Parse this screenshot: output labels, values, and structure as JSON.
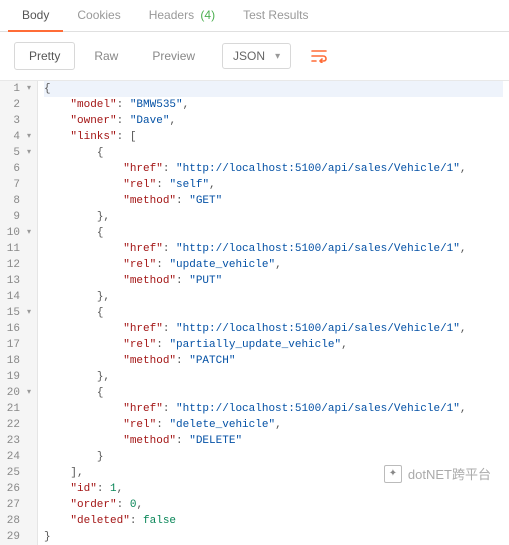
{
  "tabs": {
    "body": "Body",
    "cookies": "Cookies",
    "headers": "Headers",
    "headers_count": "(4)",
    "test_results": "Test Results"
  },
  "toolbar": {
    "pretty": "Pretty",
    "raw": "Raw",
    "preview": "Preview",
    "format": "JSON"
  },
  "watermark": "dotNET跨平台",
  "json_body": {
    "model": "BMW535",
    "owner": "Dave",
    "links": [
      {
        "href": "http://localhost:5100/api/sales/Vehicle/1",
        "rel": "self",
        "method": "GET"
      },
      {
        "href": "http://localhost:5100/api/sales/Vehicle/1",
        "rel": "update_vehicle",
        "method": "PUT"
      },
      {
        "href": "http://localhost:5100/api/sales/Vehicle/1",
        "rel": "partially_update_vehicle",
        "method": "PATCH"
      },
      {
        "href": "http://localhost:5100/api/sales/Vehicle/1",
        "rel": "delete_vehicle",
        "method": "DELETE"
      }
    ],
    "id": 1,
    "order": 0,
    "deleted": false
  },
  "code_lines": [
    {
      "n": 1,
      "fold": true,
      "indent": 0,
      "hl": true,
      "tokens": [
        [
          "p",
          "{"
        ]
      ]
    },
    {
      "n": 2,
      "fold": false,
      "indent": 1,
      "tokens": [
        [
          "k",
          "\"model\""
        ],
        [
          "p",
          ": "
        ],
        [
          "s",
          "\"BMW535\""
        ],
        [
          "p",
          ","
        ]
      ]
    },
    {
      "n": 3,
      "fold": false,
      "indent": 1,
      "tokens": [
        [
          "k",
          "\"owner\""
        ],
        [
          "p",
          ": "
        ],
        [
          "s",
          "\"Dave\""
        ],
        [
          "p",
          ","
        ]
      ]
    },
    {
      "n": 4,
      "fold": true,
      "indent": 1,
      "tokens": [
        [
          "k",
          "\"links\""
        ],
        [
          "p",
          ": ["
        ]
      ]
    },
    {
      "n": 5,
      "fold": true,
      "indent": 2,
      "tokens": [
        [
          "p",
          "{"
        ]
      ]
    },
    {
      "n": 6,
      "fold": false,
      "indent": 3,
      "tokens": [
        [
          "k",
          "\"href\""
        ],
        [
          "p",
          ": "
        ],
        [
          "s",
          "\"http://localhost:5100/api/sales/Vehicle/1\""
        ],
        [
          "p",
          ","
        ]
      ]
    },
    {
      "n": 7,
      "fold": false,
      "indent": 3,
      "tokens": [
        [
          "k",
          "\"rel\""
        ],
        [
          "p",
          ": "
        ],
        [
          "s",
          "\"self\""
        ],
        [
          "p",
          ","
        ]
      ]
    },
    {
      "n": 8,
      "fold": false,
      "indent": 3,
      "tokens": [
        [
          "k",
          "\"method\""
        ],
        [
          "p",
          ": "
        ],
        [
          "s",
          "\"GET\""
        ]
      ]
    },
    {
      "n": 9,
      "fold": false,
      "indent": 2,
      "tokens": [
        [
          "p",
          "},"
        ]
      ]
    },
    {
      "n": 10,
      "fold": true,
      "indent": 2,
      "tokens": [
        [
          "p",
          "{"
        ]
      ]
    },
    {
      "n": 11,
      "fold": false,
      "indent": 3,
      "tokens": [
        [
          "k",
          "\"href\""
        ],
        [
          "p",
          ": "
        ],
        [
          "s",
          "\"http://localhost:5100/api/sales/Vehicle/1\""
        ],
        [
          "p",
          ","
        ]
      ]
    },
    {
      "n": 12,
      "fold": false,
      "indent": 3,
      "tokens": [
        [
          "k",
          "\"rel\""
        ],
        [
          "p",
          ": "
        ],
        [
          "s",
          "\"update_vehicle\""
        ],
        [
          "p",
          ","
        ]
      ]
    },
    {
      "n": 13,
      "fold": false,
      "indent": 3,
      "tokens": [
        [
          "k",
          "\"method\""
        ],
        [
          "p",
          ": "
        ],
        [
          "s",
          "\"PUT\""
        ]
      ]
    },
    {
      "n": 14,
      "fold": false,
      "indent": 2,
      "tokens": [
        [
          "p",
          "},"
        ]
      ]
    },
    {
      "n": 15,
      "fold": true,
      "indent": 2,
      "tokens": [
        [
          "p",
          "{"
        ]
      ]
    },
    {
      "n": 16,
      "fold": false,
      "indent": 3,
      "tokens": [
        [
          "k",
          "\"href\""
        ],
        [
          "p",
          ": "
        ],
        [
          "s",
          "\"http://localhost:5100/api/sales/Vehicle/1\""
        ],
        [
          "p",
          ","
        ]
      ]
    },
    {
      "n": 17,
      "fold": false,
      "indent": 3,
      "tokens": [
        [
          "k",
          "\"rel\""
        ],
        [
          "p",
          ": "
        ],
        [
          "s",
          "\"partially_update_vehicle\""
        ],
        [
          "p",
          ","
        ]
      ]
    },
    {
      "n": 18,
      "fold": false,
      "indent": 3,
      "tokens": [
        [
          "k",
          "\"method\""
        ],
        [
          "p",
          ": "
        ],
        [
          "s",
          "\"PATCH\""
        ]
      ]
    },
    {
      "n": 19,
      "fold": false,
      "indent": 2,
      "tokens": [
        [
          "p",
          "},"
        ]
      ]
    },
    {
      "n": 20,
      "fold": true,
      "indent": 2,
      "tokens": [
        [
          "p",
          "{"
        ]
      ]
    },
    {
      "n": 21,
      "fold": false,
      "indent": 3,
      "tokens": [
        [
          "k",
          "\"href\""
        ],
        [
          "p",
          ": "
        ],
        [
          "s",
          "\"http://localhost:5100/api/sales/Vehicle/1\""
        ],
        [
          "p",
          ","
        ]
      ]
    },
    {
      "n": 22,
      "fold": false,
      "indent": 3,
      "tokens": [
        [
          "k",
          "\"rel\""
        ],
        [
          "p",
          ": "
        ],
        [
          "s",
          "\"delete_vehicle\""
        ],
        [
          "p",
          ","
        ]
      ]
    },
    {
      "n": 23,
      "fold": false,
      "indent": 3,
      "tokens": [
        [
          "k",
          "\"method\""
        ],
        [
          "p",
          ": "
        ],
        [
          "s",
          "\"DELETE\""
        ]
      ]
    },
    {
      "n": 24,
      "fold": false,
      "indent": 2,
      "tokens": [
        [
          "p",
          "}"
        ]
      ]
    },
    {
      "n": 25,
      "fold": false,
      "indent": 1,
      "tokens": [
        [
          "p",
          "],"
        ]
      ]
    },
    {
      "n": 26,
      "fold": false,
      "indent": 1,
      "tokens": [
        [
          "k",
          "\"id\""
        ],
        [
          "p",
          ": "
        ],
        [
          "n",
          "1"
        ],
        [
          "p",
          ","
        ]
      ]
    },
    {
      "n": 27,
      "fold": false,
      "indent": 1,
      "tokens": [
        [
          "k",
          "\"order\""
        ],
        [
          "p",
          ": "
        ],
        [
          "n",
          "0"
        ],
        [
          "p",
          ","
        ]
      ]
    },
    {
      "n": 28,
      "fold": false,
      "indent": 1,
      "tokens": [
        [
          "k",
          "\"deleted\""
        ],
        [
          "p",
          ": "
        ],
        [
          "n",
          "false"
        ]
      ]
    },
    {
      "n": 29,
      "fold": false,
      "indent": 0,
      "tokens": [
        [
          "p",
          "}"
        ]
      ]
    }
  ]
}
